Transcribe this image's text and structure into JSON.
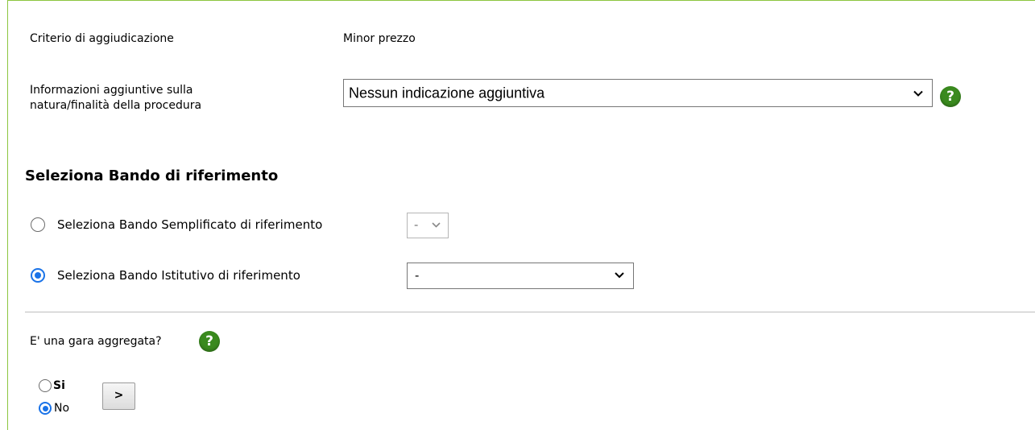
{
  "criterio": {
    "label": "Criterio di aggiudicazione",
    "value": "Minor prezzo"
  },
  "info_aggiuntive": {
    "label_line1": "Informazioni aggiuntive sulla",
    "label_line2": "natura/finalità della procedura",
    "selected": "Nessun indicazione aggiuntiva",
    "help_glyph": "?"
  },
  "bando": {
    "heading": "Seleziona Bando di riferimento",
    "semplificato": {
      "label": "Seleziona Bando Semplificato di riferimento",
      "selected": "-",
      "checked": false
    },
    "istitutivo": {
      "label": "Seleziona Bando Istitutivo di riferimento",
      "selected": "-",
      "checked": true
    }
  },
  "gara_aggregata": {
    "question": "E' una gara aggregata?",
    "help_glyph": "?",
    "options": [
      {
        "label": "Si",
        "checked": false
      },
      {
        "label": "No",
        "checked": true
      }
    ],
    "next_button": ">"
  },
  "colors": {
    "frame_border": "#8cc63f",
    "help_icon": "#3a8a1e",
    "radio_selected": "#1a73e8"
  }
}
